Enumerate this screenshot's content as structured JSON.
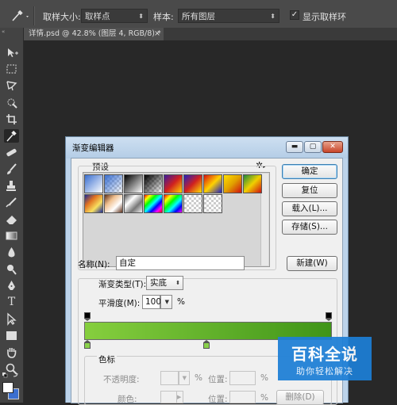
{
  "options_bar": {
    "sample_size_label": "取样大小:",
    "sample_size_value": "取样点",
    "sample_label": "样本:",
    "sample_value": "所有图层",
    "show_ring_label": "显示取样环",
    "show_ring_checked": true
  },
  "document_tab": {
    "title": "详情.psd @ 42.8% (图层 4, RGB/8) *",
    "close": "×"
  },
  "toolbar": {
    "tools": [
      "move-icon",
      "marquee-icon",
      "lasso-icon",
      "quick-select-icon",
      "crop-icon",
      "eyedropper-icon",
      "healing-icon",
      "brush-icon",
      "stamp-icon",
      "history-brush-icon",
      "eraser-icon",
      "gradient-icon",
      "blur-icon",
      "dodge-icon",
      "pen-icon",
      "type-icon",
      "path-select-icon",
      "shape-icon",
      "hand-icon",
      "zoom-icon"
    ],
    "active_tool": "eyedropper-icon"
  },
  "dialog": {
    "title": "渐变编辑器",
    "presets_label": "预设",
    "gear": "✲",
    "buttons": {
      "ok": "确定",
      "reset": "复位",
      "load": "载入(L)...",
      "save": "存储(S)...",
      "new": "新建(W)"
    },
    "name_label": "名称(N):",
    "name_value": "自定",
    "gradient_type_label": "渐变类型(T):",
    "gradient_type_value": "实底",
    "smoothness_label": "平滑度(M):",
    "smoothness_value": "100",
    "smoothness_unit": "%",
    "stops_group_label": "色标",
    "opacity_label": "不透明度:",
    "opacity_value": "",
    "opacity_unit": "%",
    "location_label": "位置:",
    "location_value": "",
    "location_unit": "%",
    "color_label": "颜色:",
    "delete": "删除(D)",
    "gradient_colors": {
      "start": "#86cf3e",
      "end": "#3f9418"
    }
  },
  "watermark": {
    "main": "百科全说",
    "sub": "助你轻松解决"
  }
}
